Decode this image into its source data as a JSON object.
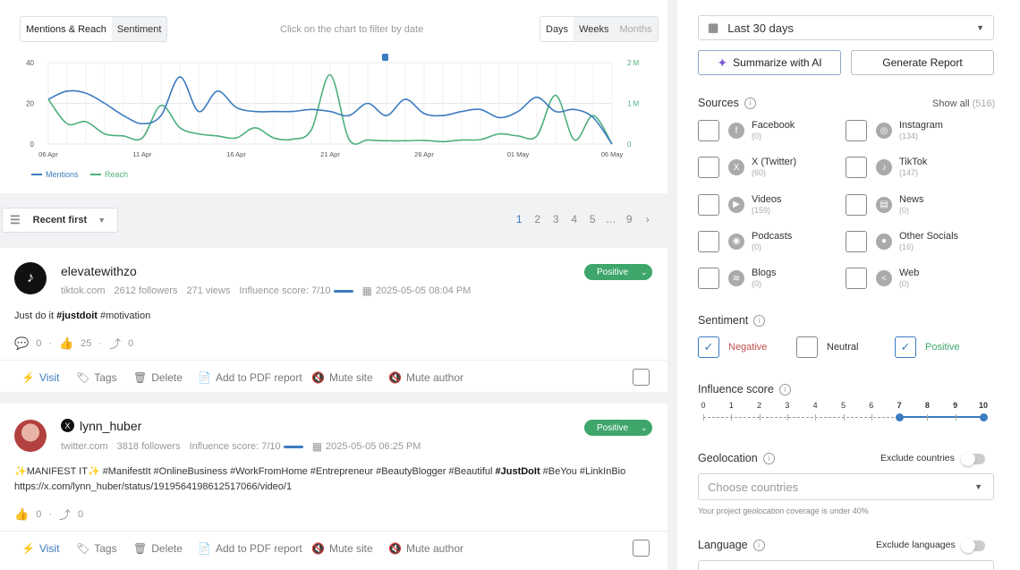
{
  "tabs": {
    "mentions_reach": "Mentions & Reach",
    "sentiment": "Sentiment"
  },
  "chart_hint": "Click on the chart to filter by date",
  "periods": {
    "days": "Days",
    "weeks": "Weeks",
    "months": "Months"
  },
  "chart_data": {
    "type": "line",
    "x": [
      "06 Apr",
      "07 Apr",
      "08 Apr",
      "09 Apr",
      "10 Apr",
      "11 Apr",
      "12 Apr",
      "13 Apr",
      "14 Apr",
      "15 Apr",
      "16 Apr",
      "17 Apr",
      "18 Apr",
      "19 Apr",
      "20 Apr",
      "21 Apr",
      "22 Apr",
      "23 Apr",
      "24 Apr",
      "25 Apr",
      "26 Apr",
      "27 Apr",
      "28 Apr",
      "29 Apr",
      "30 Apr",
      "01 May",
      "02 May",
      "03 May",
      "04 May",
      "05 May",
      "06 May"
    ],
    "x_tick_labels": [
      "06 Apr",
      "11 Apr",
      "16 Apr",
      "21 Apr",
      "26 Apr",
      "01 May",
      "06 May"
    ],
    "left_ticks": [
      "40",
      "20",
      "0"
    ],
    "right_ticks": [
      "2 M",
      "1 M",
      "0"
    ],
    "ylim_left": [
      0,
      40
    ],
    "ylim_right": [
      0,
      2000000
    ],
    "series": [
      {
        "name": "Mentions",
        "axis": "left",
        "color": "#3b7bbf",
        "values": [
          22,
          26,
          25,
          20,
          14,
          10,
          14,
          33,
          16,
          26,
          18,
          16,
          16,
          16,
          17,
          16,
          14,
          20,
          14,
          22,
          15,
          14,
          16,
          17,
          13,
          16,
          23,
          16,
          17,
          13,
          0
        ]
      },
      {
        "name": "Reach",
        "axis": "right",
        "color": "#4caf7d",
        "values": [
          1100000,
          500000,
          550000,
          250000,
          200000,
          150000,
          950000,
          400000,
          250000,
          200000,
          150000,
          400000,
          150000,
          120000,
          350000,
          1700000,
          120000,
          100000,
          80000,
          80000,
          90000,
          60000,
          100000,
          110000,
          250000,
          200000,
          200000,
          1200000,
          100000,
          700000,
          0
        ]
      }
    ]
  },
  "sort": {
    "label": "Recent first"
  },
  "pager": [
    "1",
    "2",
    "3",
    "4",
    "5",
    "…",
    "9"
  ],
  "posts": [
    {
      "author": "elevatewithzo",
      "domain": "tiktok.com",
      "followers": "2612 followers",
      "views": "271 views",
      "influence": "Influence score: 7/10",
      "date": "2025-05-05 08:04 PM",
      "sentiment": "Positive",
      "text_plain": "Just do it ",
      "text_bold": "#justdoit",
      "text_tail": " #motivation",
      "comments": "0",
      "likes": "25",
      "shares": "0"
    },
    {
      "author": "lynn_huber",
      "domain": "twitter.com",
      "followers": "3818 followers",
      "influence": "Influence score: 7/10",
      "date": "2025-05-05 06:25 PM",
      "sentiment": "Positive",
      "line1_a": "✨MANIFEST IT✨ #ManifestIt #OnlineBusiness #WorkFromHome #Entrepreneur #BeautyBlogger #Beautiful ",
      "line1_bold": "#JustDoIt",
      "line1_b": " #BeYou #LinkInBio",
      "line2": "https://x.com/lynn_huber/status/1919564198612517066/video/1",
      "likes": "0",
      "shares": "0"
    }
  ],
  "actions": {
    "visit": "Visit",
    "tags": "Tags",
    "delete": "Delete",
    "pdf": "Add to PDF report",
    "mute_site": "Mute site",
    "mute_author": "Mute author"
  },
  "filters": {
    "date_range": "Last 30 days",
    "summarize": "Summarize with AI",
    "generate": "Generate Report",
    "sources_title": "Sources",
    "show_all": "Show all",
    "show_all_count": "(516)",
    "sources": [
      {
        "label": "Facebook",
        "count": "(0)",
        "icon": "facebook-icon"
      },
      {
        "label": "Instagram",
        "count": "(134)",
        "icon": "instagram-icon"
      },
      {
        "label": "X (Twitter)",
        "count": "(60)",
        "icon": "x-icon"
      },
      {
        "label": "TikTok",
        "count": "(147)",
        "icon": "tiktok-icon"
      },
      {
        "label": "Videos",
        "count": "(159)",
        "icon": "play-icon"
      },
      {
        "label": "News",
        "count": "(0)",
        "icon": "news-icon"
      },
      {
        "label": "Podcasts",
        "count": "(0)",
        "icon": "podcast-icon"
      },
      {
        "label": "Other Socials",
        "count": "(16)",
        "icon": "chat-icon"
      },
      {
        "label": "Blogs",
        "count": "(0)",
        "icon": "rss-icon"
      },
      {
        "label": "Web",
        "count": "(0)",
        "icon": "share-icon"
      }
    ],
    "sentiment_title": "Sentiment",
    "negative": "Negative",
    "neutral": "Neutral",
    "positive": "Positive",
    "influence_title": "Influence score",
    "influence_ticks": [
      "0",
      "1",
      "2",
      "3",
      "4",
      "5",
      "6",
      "7",
      "8",
      "9",
      "10"
    ],
    "influence_range": [
      7,
      10
    ],
    "geo_title": "Geolocation",
    "exclude_countries": "Exclude countries",
    "countries_placeholder": "Choose countries",
    "geo_note": "Your project geolocation coverage is under 40%",
    "language_title": "Language",
    "exclude_languages": "Exclude languages"
  },
  "colors": {
    "accent": "#3b7bbf",
    "positive": "#3ea66b",
    "negative": "#c0504d",
    "reach": "#4caf7d"
  }
}
